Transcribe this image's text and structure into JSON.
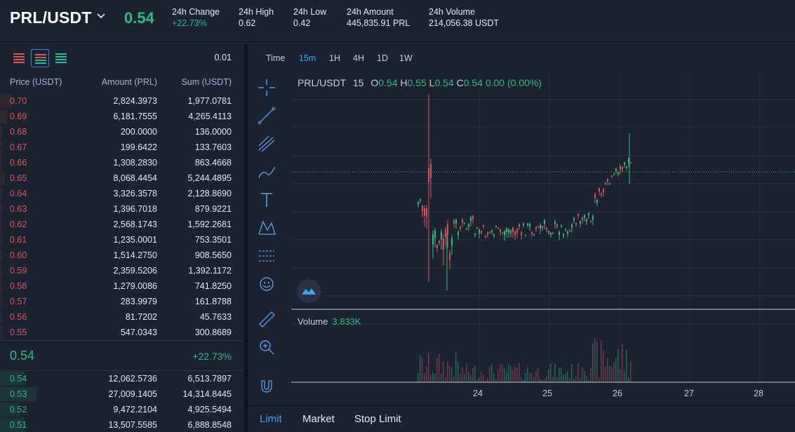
{
  "header": {
    "pair": "PRL/USDT",
    "last_price": "0.54",
    "stats": [
      {
        "label": "24h Change",
        "value": "+22.73%",
        "up": true
      },
      {
        "label": "24h High",
        "value": "0.62"
      },
      {
        "label": "24h Low",
        "value": "0.42"
      },
      {
        "label": "24h Amount",
        "value": "445,835.91 PRL"
      },
      {
        "label": "24h Volume",
        "value": "214,056.38 USDT"
      }
    ]
  },
  "orderbook": {
    "precision": "0.01",
    "headers": {
      "price": "Price (USDT)",
      "amount": "Amount (PRL)",
      "sum": "Sum (USDT)"
    },
    "asks": [
      {
        "price": "0.70",
        "amount": "2,824.3973",
        "sum": "1,977.0781",
        "depth": 0.05
      },
      {
        "price": "0.69",
        "amount": "6,181.7555",
        "sum": "4,265.4113",
        "depth": 0.03
      },
      {
        "price": "0.68",
        "amount": "200.0000",
        "sum": "136.0000",
        "depth": 0.01
      },
      {
        "price": "0.67",
        "amount": "199.6422",
        "sum": "133.7603",
        "depth": 0.01
      },
      {
        "price": "0.66",
        "amount": "1,308.2830",
        "sum": "863.4668",
        "depth": 0.01
      },
      {
        "price": "0.65",
        "amount": "8,068.4454",
        "sum": "5,244.4895",
        "depth": 0.02
      },
      {
        "price": "0.64",
        "amount": "3,326.3578",
        "sum": "2,128.8690",
        "depth": 0.01
      },
      {
        "price": "0.63",
        "amount": "1,396.7018",
        "sum": "879.9221",
        "depth": 0.01
      },
      {
        "price": "0.62",
        "amount": "2,568.1743",
        "sum": "1,592.2681",
        "depth": 0.01
      },
      {
        "price": "0.61",
        "amount": "1,235.0001",
        "sum": "753.3501",
        "depth": 0.01
      },
      {
        "price": "0.60",
        "amount": "1,514.2750",
        "sum": "908.5650",
        "depth": 0.01
      },
      {
        "price": "0.59",
        "amount": "2,359.5206",
        "sum": "1,392.1172",
        "depth": 0.01
      },
      {
        "price": "0.58",
        "amount": "1,279.0086",
        "sum": "741.8250",
        "depth": 0.01
      },
      {
        "price": "0.57",
        "amount": "283.9979",
        "sum": "161.8788",
        "depth": 0.01
      },
      {
        "price": "0.56",
        "amount": "81.7202",
        "sum": "45.7633",
        "depth": 0.01
      },
      {
        "price": "0.55",
        "amount": "547.0343",
        "sum": "300.8689",
        "depth": 0.01
      }
    ],
    "mid": {
      "price": "0.54",
      "change": "+22.73%"
    },
    "bids": [
      {
        "price": "0.54",
        "amount": "12,062.5736",
        "sum": "6,513.7897",
        "depth": 0.1
      },
      {
        "price": "0.53",
        "amount": "27,009.1405",
        "sum": "14,314.8445",
        "depth": 0.15
      },
      {
        "price": "0.52",
        "amount": "9,472.2104",
        "sum": "4,925.5494",
        "depth": 0.08
      },
      {
        "price": "0.51",
        "amount": "13,507.5585",
        "sum": "6,888.8548",
        "depth": 0.1
      }
    ]
  },
  "chart": {
    "timeframes": [
      {
        "label": "Time",
        "active": false
      },
      {
        "label": "15m",
        "active": true
      },
      {
        "label": "1H",
        "active": false
      },
      {
        "label": "4H",
        "active": false
      },
      {
        "label": "1D",
        "active": false
      },
      {
        "label": "1W",
        "active": false
      }
    ],
    "legend": {
      "symbol": "PRL/USDT",
      "interval": "15",
      "o_label": "O",
      "o": "0.54",
      "h_label": "H",
      "h": "0.55",
      "l_label": "L",
      "l": "0.54",
      "c_label": "C",
      "c": "0.54",
      "change": "0.00 (0.00%)"
    },
    "volume_label": "Volume",
    "volume_value": "3.833K",
    "x_labels": [
      "24",
      "25",
      "26",
      "27",
      "28"
    ],
    "colors": {
      "up": "#2ebd85",
      "down": "#e0535b",
      "grid": "#252e3e"
    }
  },
  "order_form": {
    "tabs": [
      {
        "label": "Limit",
        "active": true
      },
      {
        "label": "Market",
        "active": false
      },
      {
        "label": "Stop Limit",
        "active": false
      }
    ]
  }
}
